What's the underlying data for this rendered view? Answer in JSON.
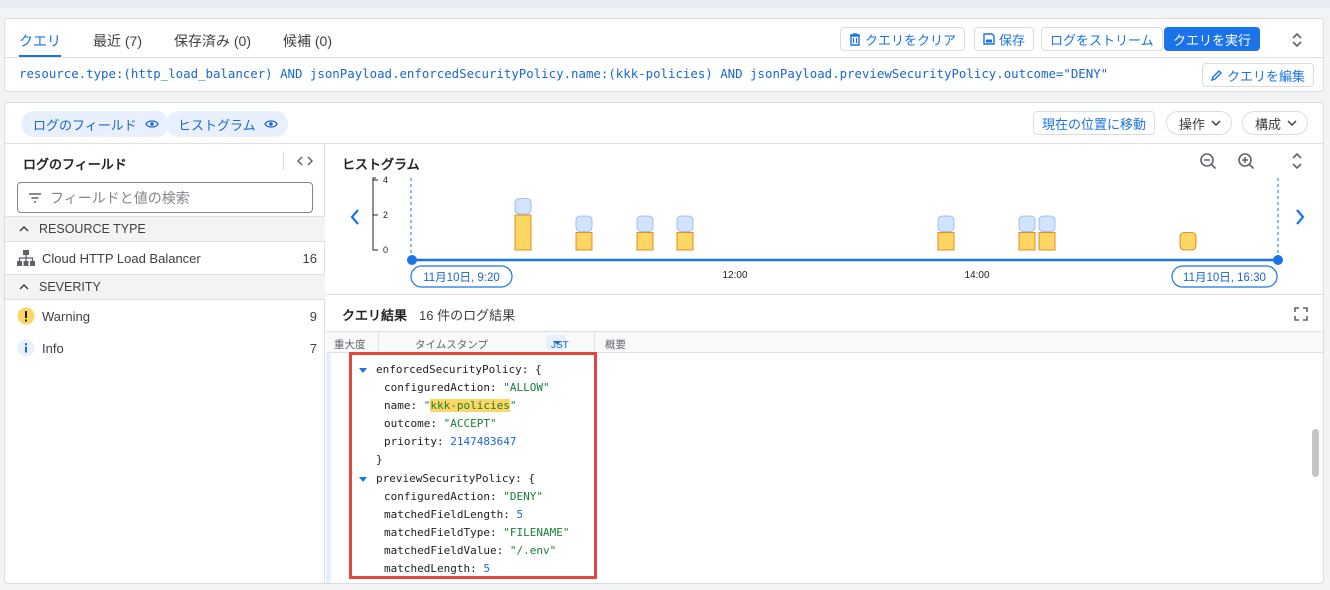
{
  "tabs": [
    {
      "label": "クエリ",
      "active": true
    },
    {
      "label": "最近 (7)",
      "active": false
    },
    {
      "label": "保存済み (0)",
      "active": false
    },
    {
      "label": "候補 (0)",
      "active": false
    }
  ],
  "toolbar": {
    "clear_label": "クエリをクリア",
    "save_label": "保存",
    "stream_label": "ログをストリーム",
    "run_label": "クエリを実行",
    "edit_label": "クエリを編集"
  },
  "query": "resource.type:(http_load_balancer) AND jsonPayload.enforcedSecurityPolicy.name:(kkk-policies) AND jsonPayload.previewSecurityPolicy.outcome=\"DENY\"",
  "chips": {
    "log_fields": "ログのフィールド",
    "histogram": "ヒストグラム"
  },
  "actions": {
    "jump_now": "現在の位置に移動",
    "operations": "操作",
    "configure": "構成"
  },
  "fields_panel": {
    "title": "ログのフィールド",
    "search_placeholder": "フィールドと値の検索",
    "sections": [
      {
        "label": "RESOURCE TYPE",
        "items": [
          {
            "label": "Cloud HTTP Load Balancer",
            "count": "16",
            "icon": "sitemap-icon"
          }
        ]
      },
      {
        "label": "SEVERITY",
        "items": [
          {
            "label": "Warning",
            "count": "9",
            "icon": "warning-icon"
          },
          {
            "label": "Info",
            "count": "7",
            "icon": "info-icon"
          }
        ]
      }
    ]
  },
  "histogram": {
    "title": "ヒストグラム",
    "y_ticks": [
      "4",
      "2",
      "0"
    ],
    "x_ticks": [
      "12:00",
      "14:00"
    ],
    "start_label": "11月10日, 9:20",
    "end_label": "11月10日, 16:30",
    "colors": {
      "warning": "#fdd663",
      "warning_stroke": "#e37400",
      "info": "#d2e3fc",
      "info_stroke": "#8ab4f8",
      "axis": "#1a73e8"
    },
    "bars": [
      {
        "warning": 2,
        "info": 1
      },
      {
        "warning": 1,
        "info": 1
      },
      {
        "warning": 1,
        "info": 1
      },
      {
        "warning": 1,
        "info": 1
      },
      {
        "warning": 1,
        "info": 1
      },
      {
        "warning": 1,
        "info": 1
      },
      {
        "warning": 1,
        "info": 1
      },
      {
        "warning": 1,
        "info": 0
      }
    ]
  },
  "results": {
    "title": "クエリ結果",
    "count": "16 件のログ結果",
    "columns": {
      "severity": "重大度",
      "timestamp": "タイムスタンプ",
      "tz": "JST",
      "summary": "概要"
    },
    "lines": {
      "enforced_key": "enforcedSecurityPolicy",
      "configured_action_key": "configuredAction",
      "configured_action_val": "\"ALLOW\"",
      "name_key": "name",
      "name_val": "kkk-policies",
      "outcome_key": "outcome",
      "outcome_val": "\"ACCEPT\"",
      "priority_key": "priority",
      "priority_val": "2147483647",
      "preview_key": "previewSecurityPolicy",
      "p_action_key": "configuredAction",
      "p_action_val": "\"DENY\"",
      "mfl_key": "matchedFieldLength",
      "mfl_val": "5",
      "mft_key": "matchedFieldType",
      "mft_val": "\"FILENAME\"",
      "mfv_key": "matchedFieldValue",
      "mfv_val": "\"/.env\"",
      "ml_key": "matchedLength",
      "ml_val": "5"
    }
  }
}
